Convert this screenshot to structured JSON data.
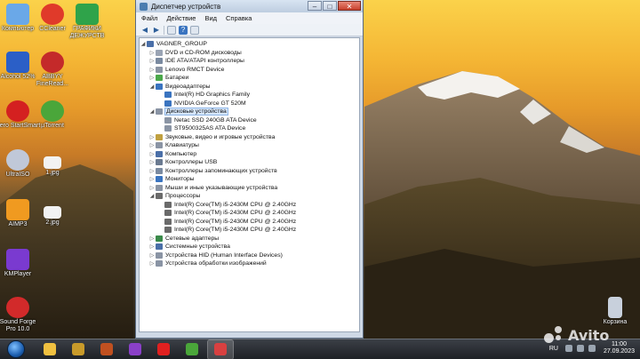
{
  "desktop": {
    "icons": [
      {
        "label": "Компьютер",
        "icon": "computer-icon",
        "color": "#6aa8e8"
      },
      {
        "label": "CCleaner",
        "icon": "ccleaner-icon",
        "color": "#e03a2a"
      },
      {
        "label": "ГРАФИКИ ДЕЖУРСТВ",
        "icon": "shield-check-icon",
        "color": "#2fa34a"
      },
      {
        "label": "Alcohol 52%",
        "icon": "alcohol-icon",
        "color": "#2b5fc7"
      },
      {
        "label": "ABBYY FineRead...",
        "icon": "abbyy-icon",
        "color": "#c42a2a"
      },
      {
        "label": "Nero StartSmart",
        "icon": "nero-icon",
        "color": "#d42020"
      },
      {
        "label": "µTorrent",
        "icon": "utorrent-icon",
        "color": "#4aa63a"
      },
      {
        "label": "UltraISO",
        "icon": "disc-icon",
        "color": "#c0c8d8"
      },
      {
        "label": "1.jpg",
        "icon": "image-file-icon",
        "color": "#f2f2f2"
      },
      {
        "label": "AIMP3",
        "icon": "aimp-icon",
        "color": "#f09a20"
      },
      {
        "label": "2.jpg",
        "icon": "image-file-icon",
        "color": "#f2f2f2"
      },
      {
        "label": "KMPlayer",
        "icon": "kmplayer-icon",
        "color": "#7a3ad0"
      },
      {
        "label": "Sound Forge Pro 10.0",
        "icon": "soundforge-icon",
        "color": "#d22a2a"
      },
      {
        "label": "Корзина",
        "icon": "recycle-bin-icon",
        "color": "#c8d0dc"
      }
    ]
  },
  "window": {
    "title": "Диспетчер устройств",
    "menu": [
      "Файл",
      "Действие",
      "Вид",
      "Справка"
    ],
    "controls": {
      "minimize": "–",
      "maximize": "□",
      "close": "✕"
    },
    "toolbar": [
      "back-icon",
      "forward-icon",
      "properties-icon",
      "help-icon",
      "scan-icon"
    ],
    "tree": [
      {
        "label": "VAGNER_GROUP",
        "depth": 0,
        "expander": "◢",
        "icon": "#4a6fa8"
      },
      {
        "label": "DVD и CD-ROM дисководы",
        "depth": 1,
        "expander": "▷",
        "icon": "#9aa4b4"
      },
      {
        "label": "IDE ATA/ATAPI контроллеры",
        "depth": 1,
        "expander": "▷",
        "icon": "#7a8aa0"
      },
      {
        "label": "Lenovo RMCT Device",
        "depth": 1,
        "expander": "▷",
        "icon": "#8a94a4"
      },
      {
        "label": "Батареи",
        "depth": 1,
        "expander": "▷",
        "icon": "#4aa84a"
      },
      {
        "label": "Видеоадаптеры",
        "depth": 1,
        "expander": "◢",
        "icon": "#3a74c0"
      },
      {
        "label": "Intel(R) HD Graphics Family",
        "depth": 2,
        "expander": "",
        "icon": "#3a74c0"
      },
      {
        "label": "NVIDIA GeForce GT 520M",
        "depth": 2,
        "expander": "",
        "icon": "#3a74c0"
      },
      {
        "label": "Дисковые устройства",
        "depth": 1,
        "expander": "◢",
        "icon": "#8a94a4",
        "selected": true
      },
      {
        "label": "Netac SSD 240GB ATA Device",
        "depth": 2,
        "expander": "",
        "icon": "#8a94a4"
      },
      {
        "label": "ST9500325AS ATA Device",
        "depth": 2,
        "expander": "",
        "icon": "#8a94a4"
      },
      {
        "label": "Звуковые, видео и игровые устройства",
        "depth": 1,
        "expander": "▷",
        "icon": "#c0a040"
      },
      {
        "label": "Клавиатуры",
        "depth": 1,
        "expander": "▷",
        "icon": "#8a94a4"
      },
      {
        "label": "Компьютер",
        "depth": 1,
        "expander": "▷",
        "icon": "#4a6fa8"
      },
      {
        "label": "Контроллеры USB",
        "depth": 1,
        "expander": "▷",
        "icon": "#6a7a90"
      },
      {
        "label": "Контроллеры запоминающих устройств",
        "depth": 1,
        "expander": "▷",
        "icon": "#7a8aa0"
      },
      {
        "label": "Мониторы",
        "depth": 1,
        "expander": "▷",
        "icon": "#3a74c0"
      },
      {
        "label": "Мыши и иные указывающие устройства",
        "depth": 1,
        "expander": "▷",
        "icon": "#8a94a4"
      },
      {
        "label": "Процессоры",
        "depth": 1,
        "expander": "◢",
        "icon": "#6a6a6a"
      },
      {
        "label": "Intel(R) Core(TM) i5-2430M CPU @ 2.40GHz",
        "depth": 2,
        "expander": "",
        "icon": "#6a6a6a"
      },
      {
        "label": "Intel(R) Core(TM) i5-2430M CPU @ 2.40GHz",
        "depth": 2,
        "expander": "",
        "icon": "#6a6a6a"
      },
      {
        "label": "Intel(R) Core(TM) i5-2430M CPU @ 2.40GHz",
        "depth": 2,
        "expander": "",
        "icon": "#6a6a6a"
      },
      {
        "label": "Intel(R) Core(TM) i5-2430M CPU @ 2.40GHz",
        "depth": 2,
        "expander": "",
        "icon": "#6a6a6a"
      },
      {
        "label": "Сетевые адаптеры",
        "depth": 1,
        "expander": "▷",
        "icon": "#3a8a4a"
      },
      {
        "label": "Системные устройства",
        "depth": 1,
        "expander": "▷",
        "icon": "#4a6fa8"
      },
      {
        "label": "Устройства HID (Human Interface Devices)",
        "depth": 1,
        "expander": "▷",
        "icon": "#8a94a4"
      },
      {
        "label": "Устройства обработки изображений",
        "depth": 1,
        "expander": "▷",
        "icon": "#8a94a4"
      }
    ]
  },
  "taskbar": {
    "apps": [
      {
        "icon": "explorer-icon",
        "color": "#f0c040"
      },
      {
        "icon": "world-of-warcraft-icon",
        "color": "#c89a2a"
      },
      {
        "icon": "game-character-icon",
        "color": "#c05020"
      },
      {
        "icon": "visual-studio-icon",
        "color": "#8a40c8"
      },
      {
        "icon": "opera-icon",
        "color": "#e02020"
      },
      {
        "icon": "utorrent-icon",
        "color": "#4aa63a"
      },
      {
        "icon": "device-manager-icon",
        "color": "#d84040",
        "active": true
      }
    ],
    "language": "RU",
    "time": "11:00",
    "date": "27.09.2023"
  },
  "watermark": {
    "text": "Avito"
  }
}
